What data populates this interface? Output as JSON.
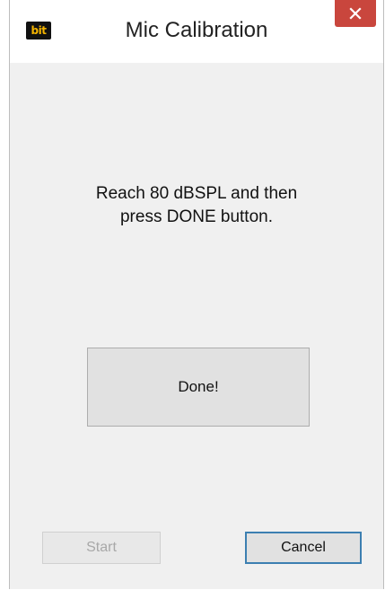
{
  "window": {
    "title": "Mic Calibration",
    "logo_text": "bit",
    "close_icon": "close-icon"
  },
  "dialog": {
    "instruction_line1": "Reach 80 dBSPL and then",
    "instruction_line2": "press DONE button.",
    "done_label": "Done!",
    "start_label": "Start",
    "start_enabled": false,
    "cancel_label": "Cancel"
  },
  "colors": {
    "close_button": "#c9463d",
    "client_background": "#f0f0f0",
    "logo_background": "#111111",
    "logo_text": "#f4b400",
    "focus_border": "#3c7fb1"
  }
}
